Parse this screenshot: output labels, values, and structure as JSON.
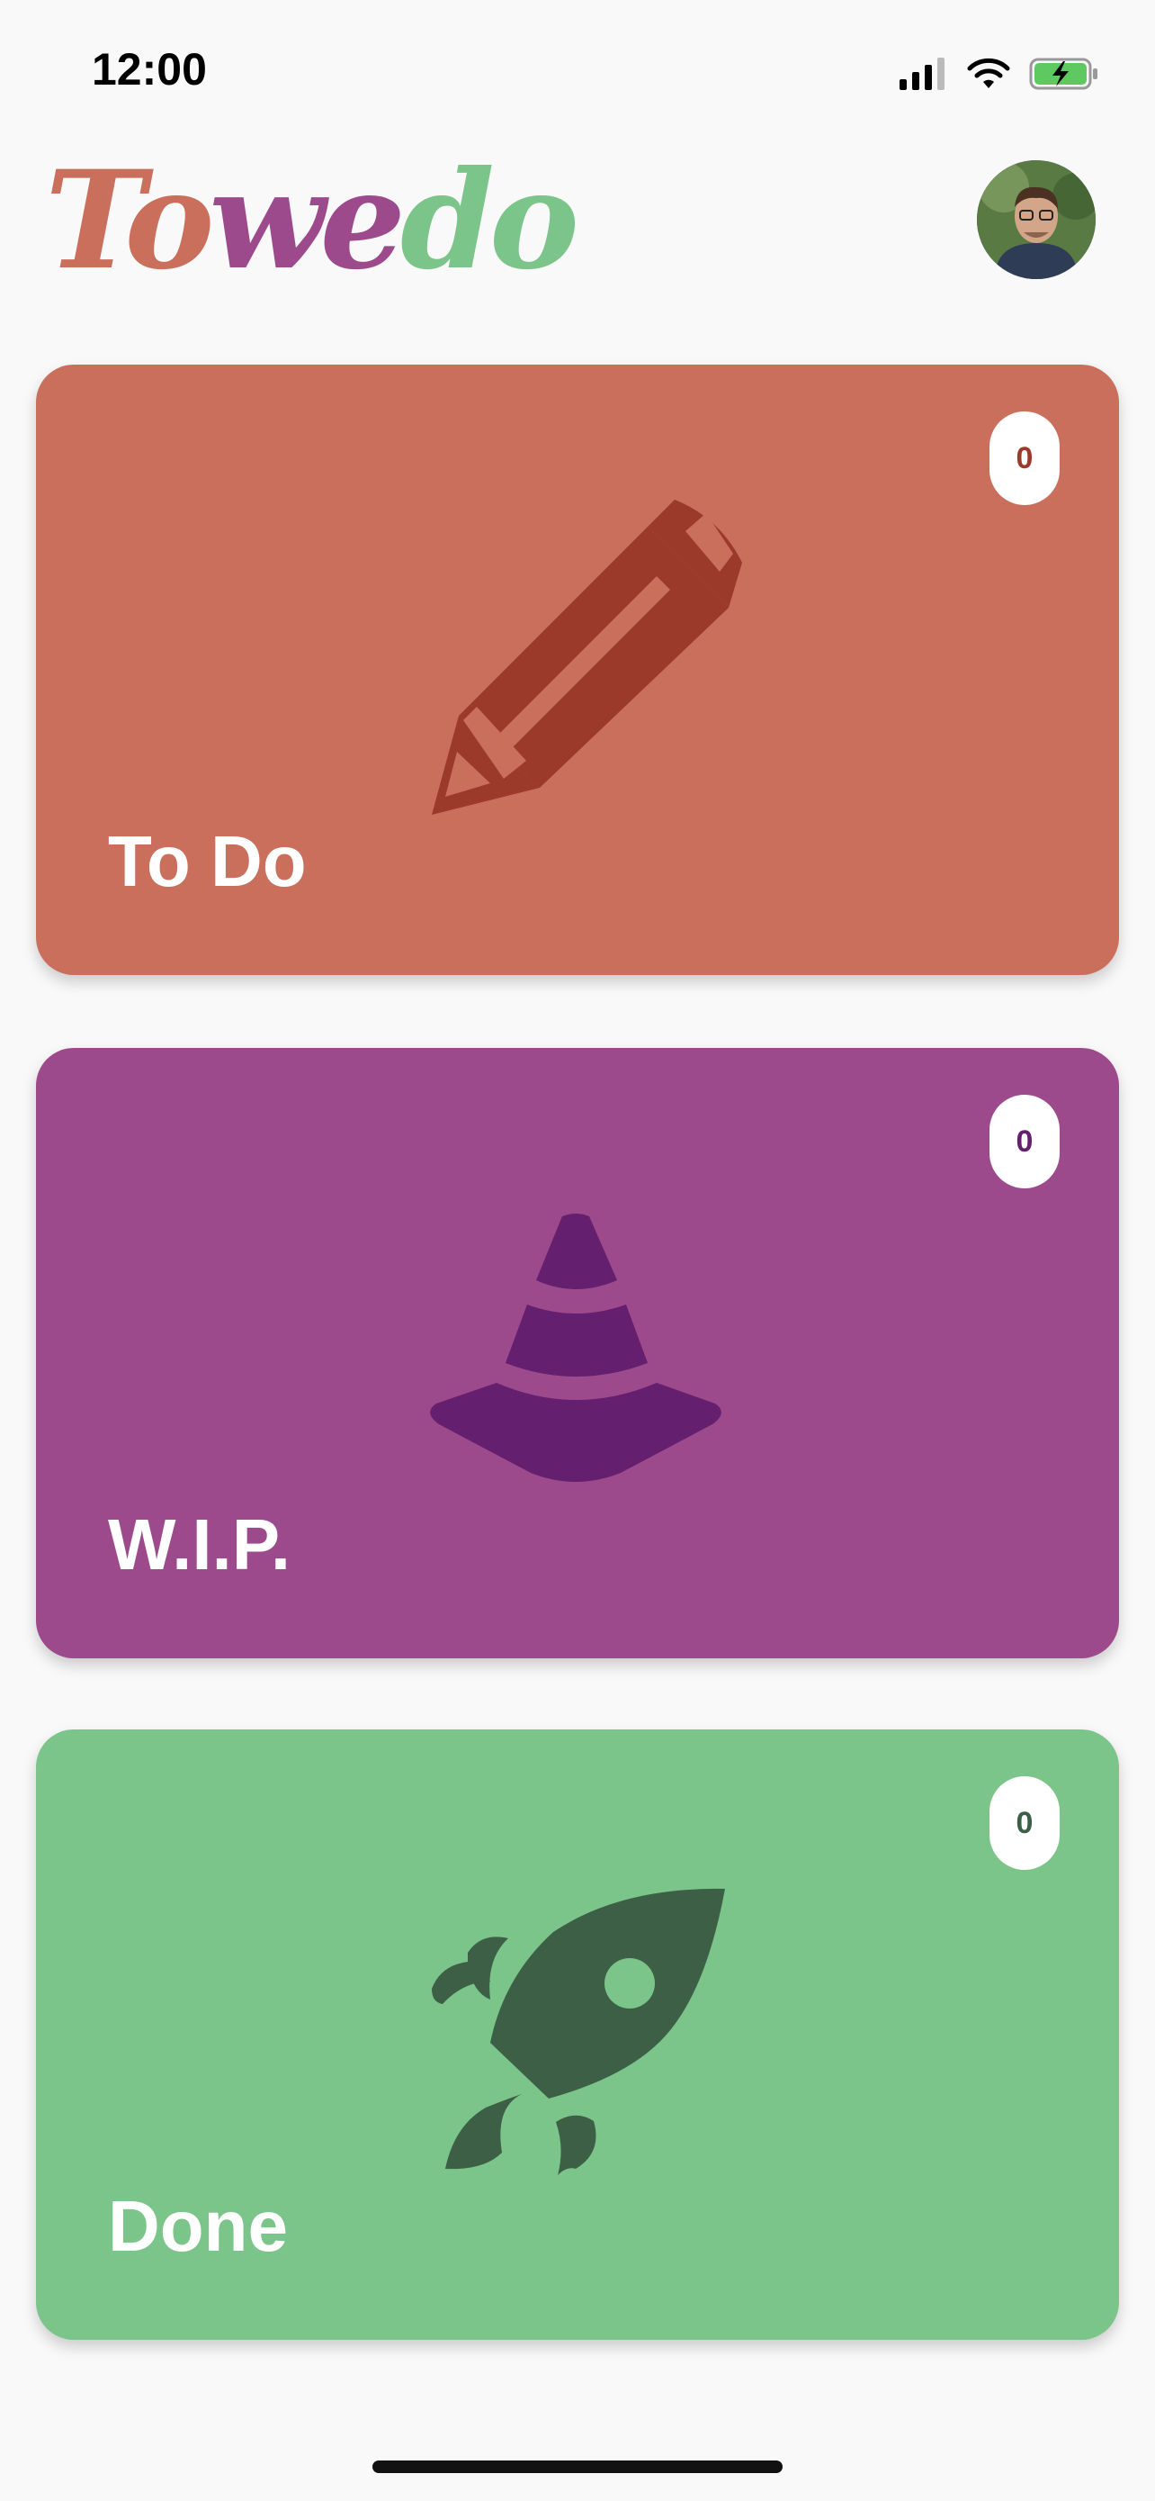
{
  "status_bar": {
    "time": "12:00",
    "icons": [
      "signal-icon",
      "wifi-icon",
      "battery-charging-icon"
    ]
  },
  "header": {
    "logo": {
      "part1": "To",
      "part2": "we",
      "part3": "do"
    },
    "avatar": "avatar"
  },
  "cards": [
    {
      "title": "To Do",
      "count": "0",
      "icon": "pencil-icon",
      "color": "#c96f5c",
      "icon_color": "#9b3a2a"
    },
    {
      "title": "W.I.P.",
      "count": "0",
      "icon": "traffic-cone-icon",
      "color": "#9c4a8c",
      "icon_color": "#641f6e"
    },
    {
      "title": "Done",
      "count": "0",
      "icon": "rocket-icon",
      "color": "#7bc48a",
      "icon_color": "#3c5f45"
    }
  ]
}
